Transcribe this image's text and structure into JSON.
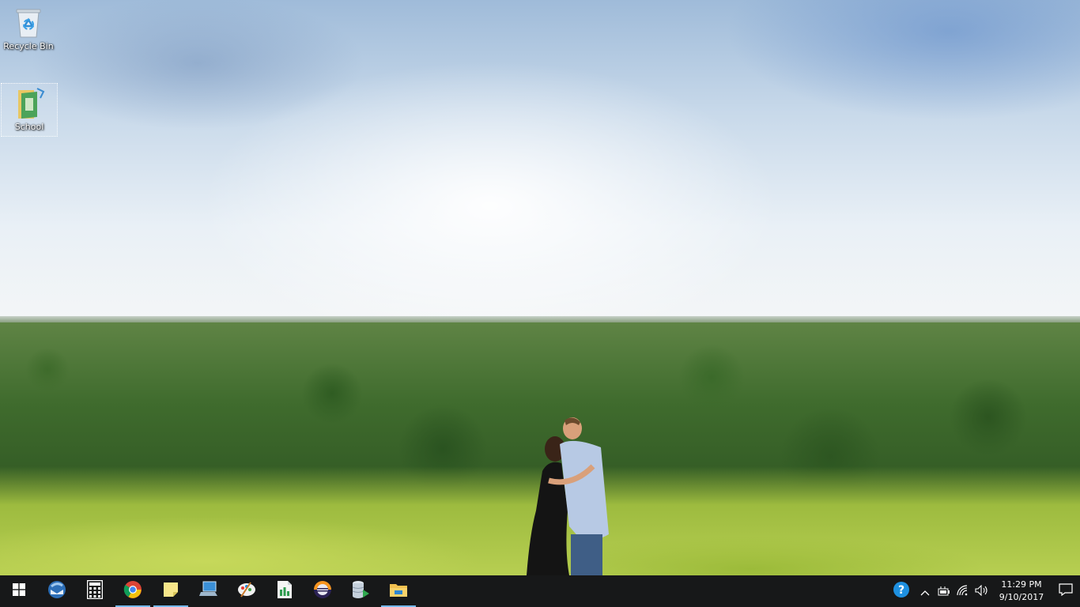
{
  "desktop": {
    "icons": [
      {
        "label": "Recycle Bin",
        "icon": "recycle-bin-icon"
      },
      {
        "label": "School",
        "icon": "folder-shortcut-icon",
        "selected": true
      }
    ]
  },
  "taskbar": {
    "start": {
      "icon": "windows-logo-icon"
    },
    "apps": [
      {
        "icon": "thunderbird-icon",
        "running": false
      },
      {
        "icon": "calculator-icon",
        "running": false
      },
      {
        "icon": "chrome-icon",
        "running": true
      },
      {
        "icon": "sticky-notes-icon",
        "running": true
      },
      {
        "icon": "remote-desktop-icon",
        "running": false
      },
      {
        "icon": "paint-icon",
        "running": false
      },
      {
        "icon": "spreadsheet-icon",
        "running": false
      },
      {
        "icon": "eclipse-icon",
        "running": false
      },
      {
        "icon": "database-icon",
        "running": false
      },
      {
        "icon": "file-explorer-icon",
        "running": true
      }
    ]
  },
  "tray": {
    "icons": [
      "help-icon",
      "chevron-up-icon",
      "battery-icon",
      "wifi-icon",
      "volume-icon"
    ],
    "time": "11:29 PM",
    "date": "9/10/2017",
    "notification_icon": "notification-icon"
  },
  "colors": {
    "taskbar_bg": "#101010",
    "running_indicator": "#76b9ed"
  }
}
